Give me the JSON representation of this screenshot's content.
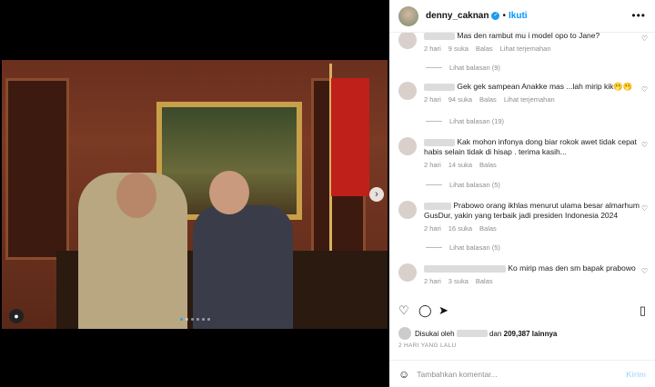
{
  "post": {
    "username": "denny_caknan",
    "follow_label": "Ikuti",
    "more_icon": "more-horizontal-icon"
  },
  "comments": [
    {
      "text": "Mas den rambut mu i model opo to Jane?",
      "age": "2 hari",
      "likes": "9 suka",
      "reply": "Balas",
      "translate": "Lihat terjemahan",
      "view_replies": "Lihat balasan (9)"
    },
    {
      "text": "Gek gek sampean Anakke mas ...lah mirip kik🫢🫢",
      "age": "2 hari",
      "likes": "94 suka",
      "reply": "Balas",
      "translate": "Lihat terjemahan",
      "view_replies": "Lihat balasan (19)"
    },
    {
      "text": "Kak mohon infonya dong biar rokok awet tidak cepat habis selain tidak di hisap . terima kasih...",
      "age": "2 hari",
      "likes": "14 suka",
      "reply": "Balas",
      "translate": "",
      "view_replies": "Lihat balasan (5)"
    },
    {
      "text": "Prabowo orang ikhlas menurut ulama besar almarhum GusDur, yakin yang terbaik jadi presiden Indonesia 2024",
      "age": "2 hari",
      "likes": "16 suka",
      "reply": "Balas",
      "translate": "",
      "view_replies": "Lihat balasan (5)"
    },
    {
      "text": "Ko mirip mas den sm bapak prabowo",
      "age": "2 hari",
      "likes": "3 suka",
      "reply": "Balas",
      "translate": "",
      "view_replies": ""
    }
  ],
  "likes": {
    "prefix": "Disukai oleh",
    "and": "dan",
    "count": "209,387 lainnya"
  },
  "timestamp": "2 HARI YANG LALU",
  "composer": {
    "placeholder": "Tambahkan komentar...",
    "send_label": "Kirim"
  },
  "colors": {
    "accent": "#0095f6",
    "verified": "#1d9bf0",
    "muted": "#8e8e8e"
  }
}
